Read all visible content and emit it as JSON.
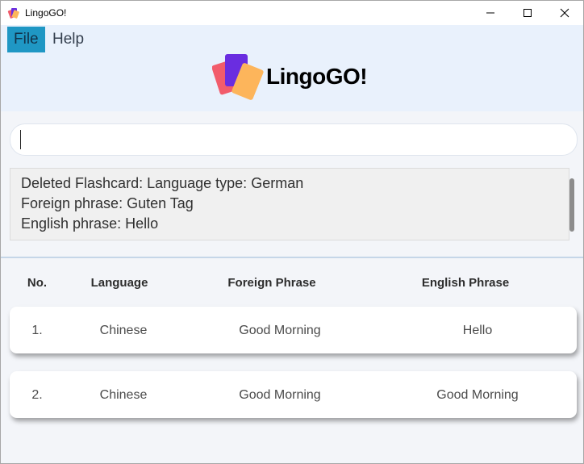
{
  "window": {
    "title": "LingoGO!"
  },
  "menu": {
    "file": "File",
    "help": "Help"
  },
  "logo": {
    "text": "LingoGO!"
  },
  "command_box": {
    "value": "",
    "placeholder": ""
  },
  "result": {
    "lines": [
      "Deleted Flashcard: Language type: German",
      "Foreign phrase: Guten Tag",
      "English phrase: Hello"
    ]
  },
  "table": {
    "headers": [
      "No.",
      "Language",
      "Foreign Phrase",
      "English Phrase"
    ],
    "rows": [
      {
        "no": "1.",
        "language": "Chinese",
        "foreign": "Good Morning",
        "english": "Hello"
      },
      {
        "no": "2.",
        "language": "Chinese",
        "foreign": "Good Morning",
        "english": "Good Morning"
      }
    ]
  },
  "colors": {
    "header_bg": "#e9f1fc",
    "menu_active": "#1f97c4",
    "body_bg": "#f3f5f9"
  },
  "icons": [
    "app-icon",
    "minimize-icon",
    "maximize-icon",
    "close-icon",
    "logo-cards-icon"
  ]
}
